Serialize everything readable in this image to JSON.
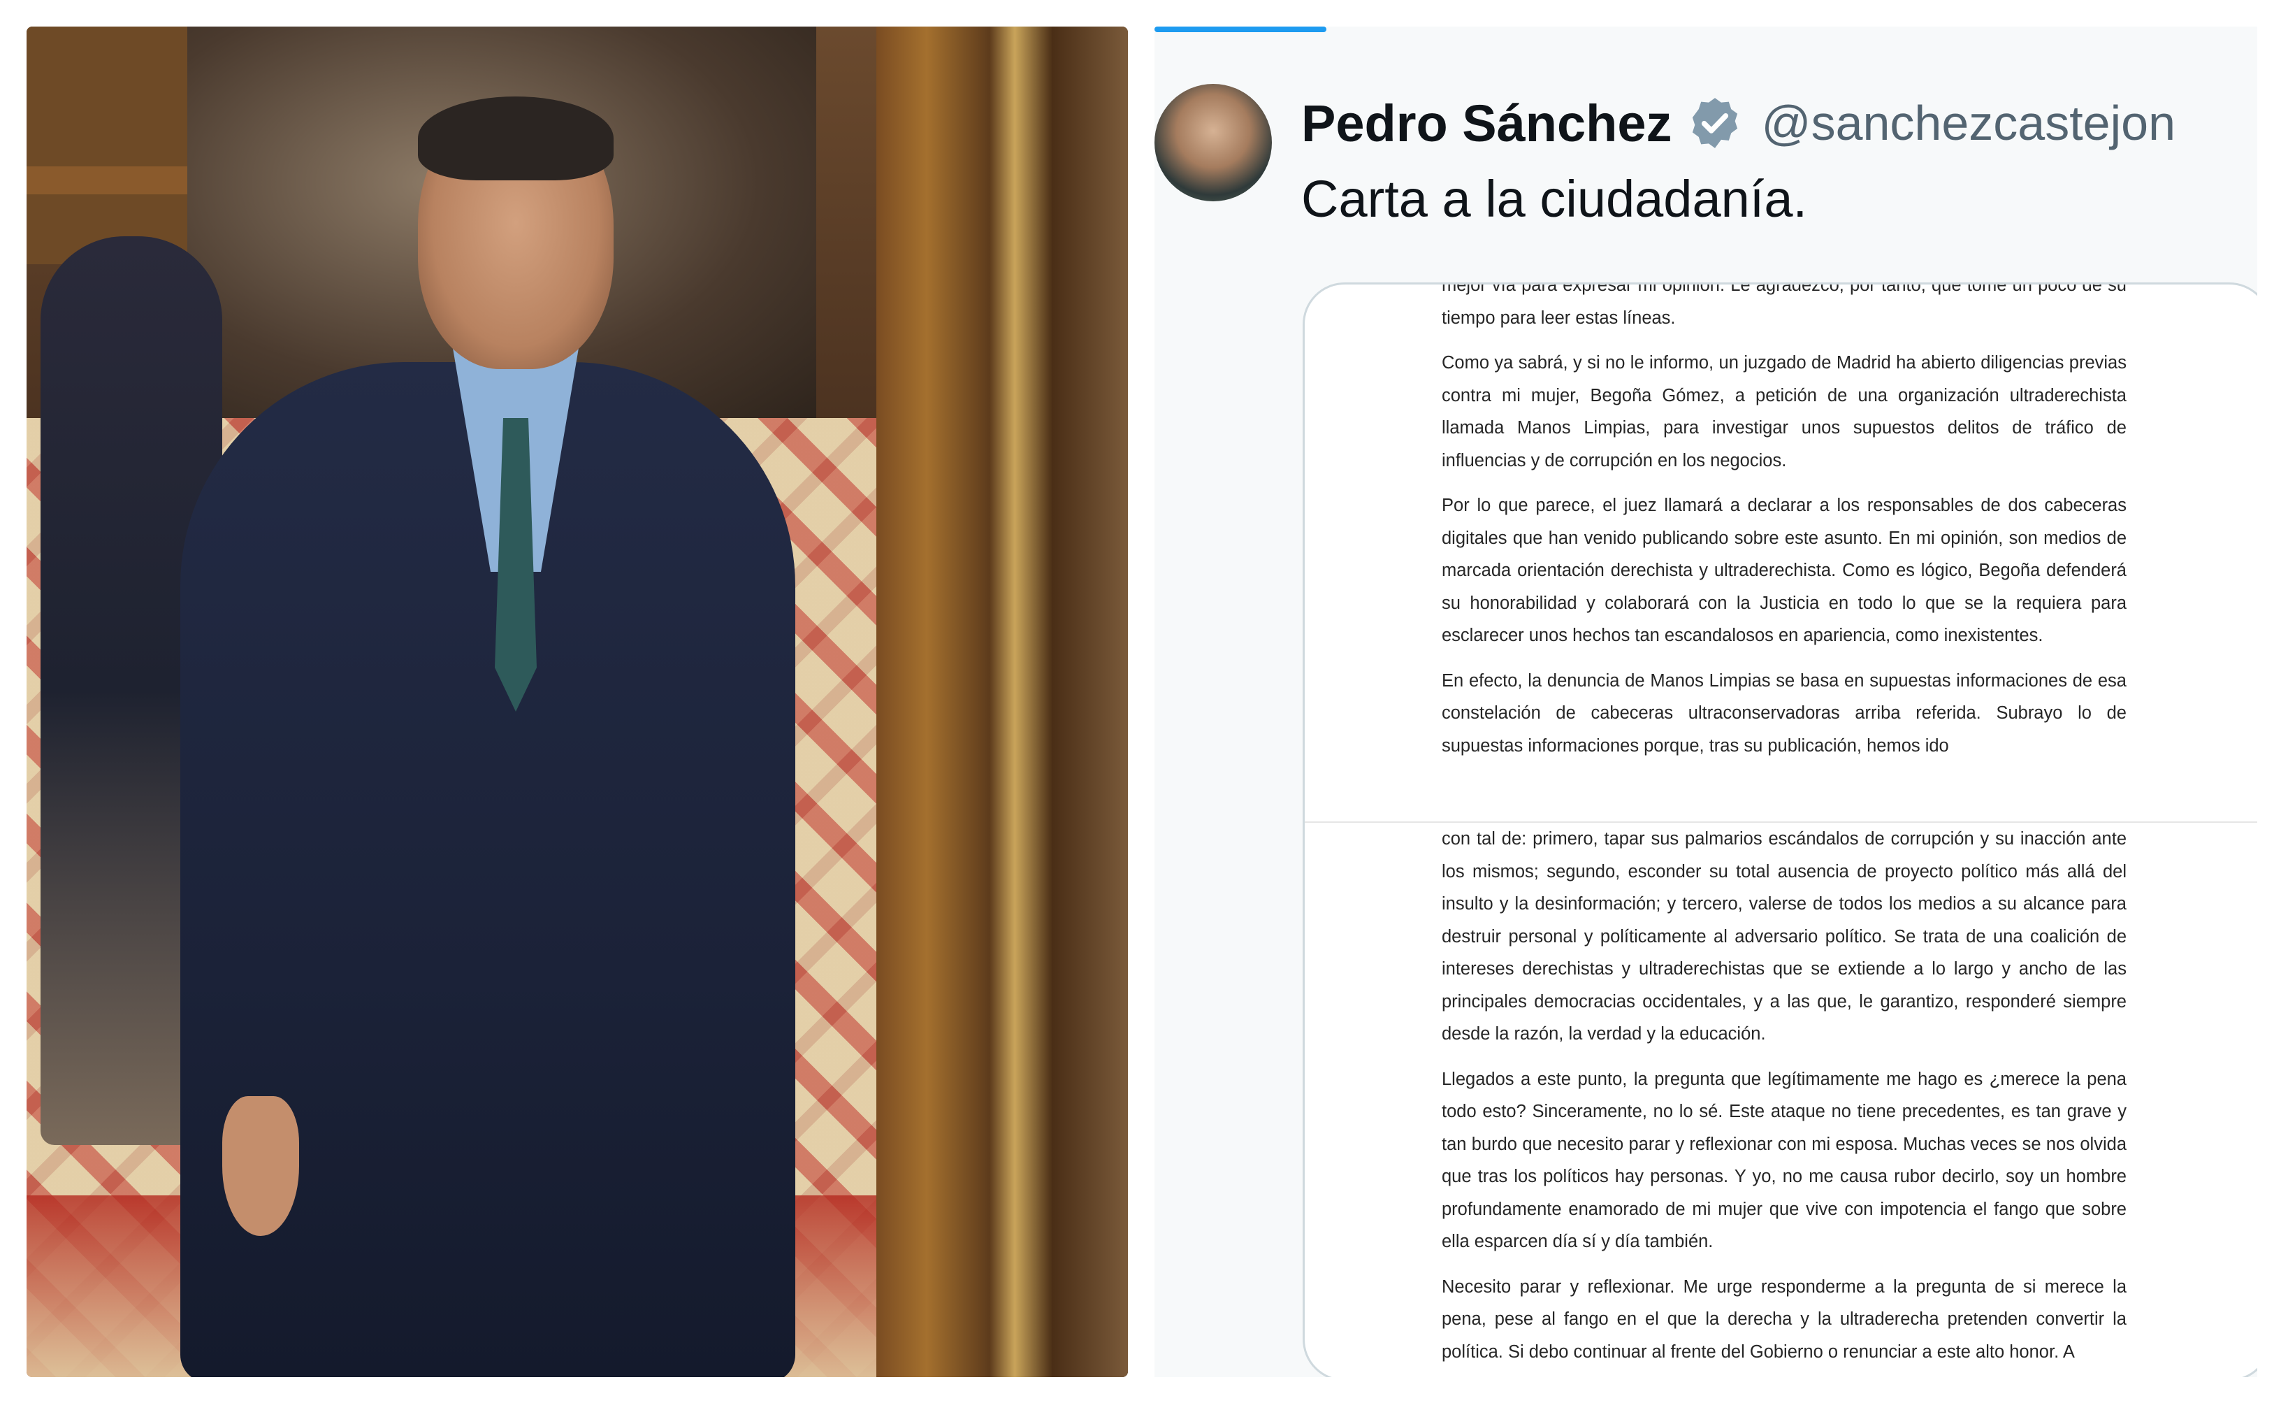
{
  "tweet": {
    "author_name": "Pedro Sánchez",
    "handle": "@sanchezcastejon",
    "text": "Carta a la ciudadanía.",
    "accent_color": "#1d9bf0"
  },
  "letter": {
    "upper": [
      "mejor vía para expresar mi opinión. Le agradezco, por tanto, que tome un poco de su tiempo para leer estas líneas.",
      "Como ya sabrá, y si no le informo, un juzgado de Madrid ha abierto diligencias previas contra mi mujer, Begoña Gómez, a petición de una organización ultraderechista llamada Manos Limpias, para investigar unos supuestos delitos de tráfico de influencias y de corrupción en los negocios.",
      "Por lo que parece, el juez llamará a declarar a los responsables de dos cabeceras digitales que han venido publicando sobre este asunto. En mi opinión, son medios de marcada orientación derechista y ultraderechista. Como es lógico, Begoña defenderá su honorabilidad y colaborará con la Justicia en todo lo que se la requiera para esclarecer unos hechos tan escandalosos en apariencia, como inexistentes.",
      "En efecto, la denuncia de Manos Limpias se basa en supuestas informaciones de esa constelación de cabeceras ultraconservadoras arriba referida. Subrayo lo de supuestas informaciones porque, tras su publicación, hemos ido"
    ],
    "lower": [
      "con tal de: primero, tapar sus palmarios escándalos de corrupción y su inacción ante los mismos; segundo, esconder su total ausencia de proyecto político más allá del insulto y la desinformación; y tercero, valerse de todos los medios a su alcance para destruir personal y políticamente al adversario político. Se trata de una coalición de intereses derechistas y ultraderechistas que se extiende a lo largo y ancho de las principales democracias occidentales, y a las que, le garantizo, responderé siempre desde la razón, la verdad y la educación.",
      "Llegados a este punto, la pregunta que legítimamente me hago es ¿merece la pena todo esto? Sinceramente, no lo sé. Este ataque no tiene precedentes, es tan grave y tan burdo que necesito parar y reflexionar con mi esposa. Muchas veces se nos olvida que tras los políticos hay personas. Y yo, no me causa rubor decirlo, soy un hombre profundamente enamorado de mi mujer que vive con impotencia el fango que sobre ella esparcen día sí y día también.",
      "Necesito parar y reflexionar. Me urge responderme a la pregunta de si merece la pena, pese al fango en el que la derecha y la ultraderecha pretenden convertir la política. Si debo continuar al frente del Gobierno o renunciar a este alto honor. A"
    ]
  }
}
